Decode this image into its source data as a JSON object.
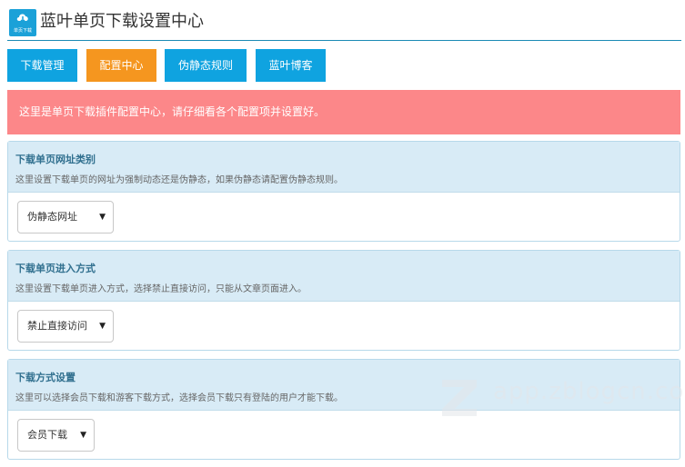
{
  "header": {
    "logo_text": "单页下载",
    "title": "蓝叶单页下载设置中心"
  },
  "tabs": [
    {
      "label": "下载管理"
    },
    {
      "label": "配置中心"
    },
    {
      "label": "伪静态规则"
    },
    {
      "label": "蓝叶博客"
    }
  ],
  "alert": {
    "text": "这里是单页下载插件配置中心，请仔细看各个配置项并设置好。"
  },
  "panels": [
    {
      "title": "下载单页网址类别",
      "desc": "这里设置下载单页的网址为强制动态还是伪静态，如果伪静态请配置伪静态规则。",
      "selected": "伪静态网址"
    },
    {
      "title": "下载单页进入方式",
      "desc": "这里设置下载单页进入方式，选择禁止直接访问，只能从文章页面进入。",
      "selected": "禁止直接访问"
    },
    {
      "title": "下载方式设置",
      "desc": "这里可以选择会员下载和游客下载方式，选择会员下载只有登陆的用户才能下载。",
      "selected": "会员下载"
    }
  ],
  "watermark": {
    "text": "app.zblogcn.com"
  },
  "colors": {
    "tab_blue": "#0fa3e0",
    "tab_active": "#f5961f",
    "alert_bg": "#fc8789",
    "panel_head": "#d8ebf6",
    "panel_title": "#31708f"
  }
}
